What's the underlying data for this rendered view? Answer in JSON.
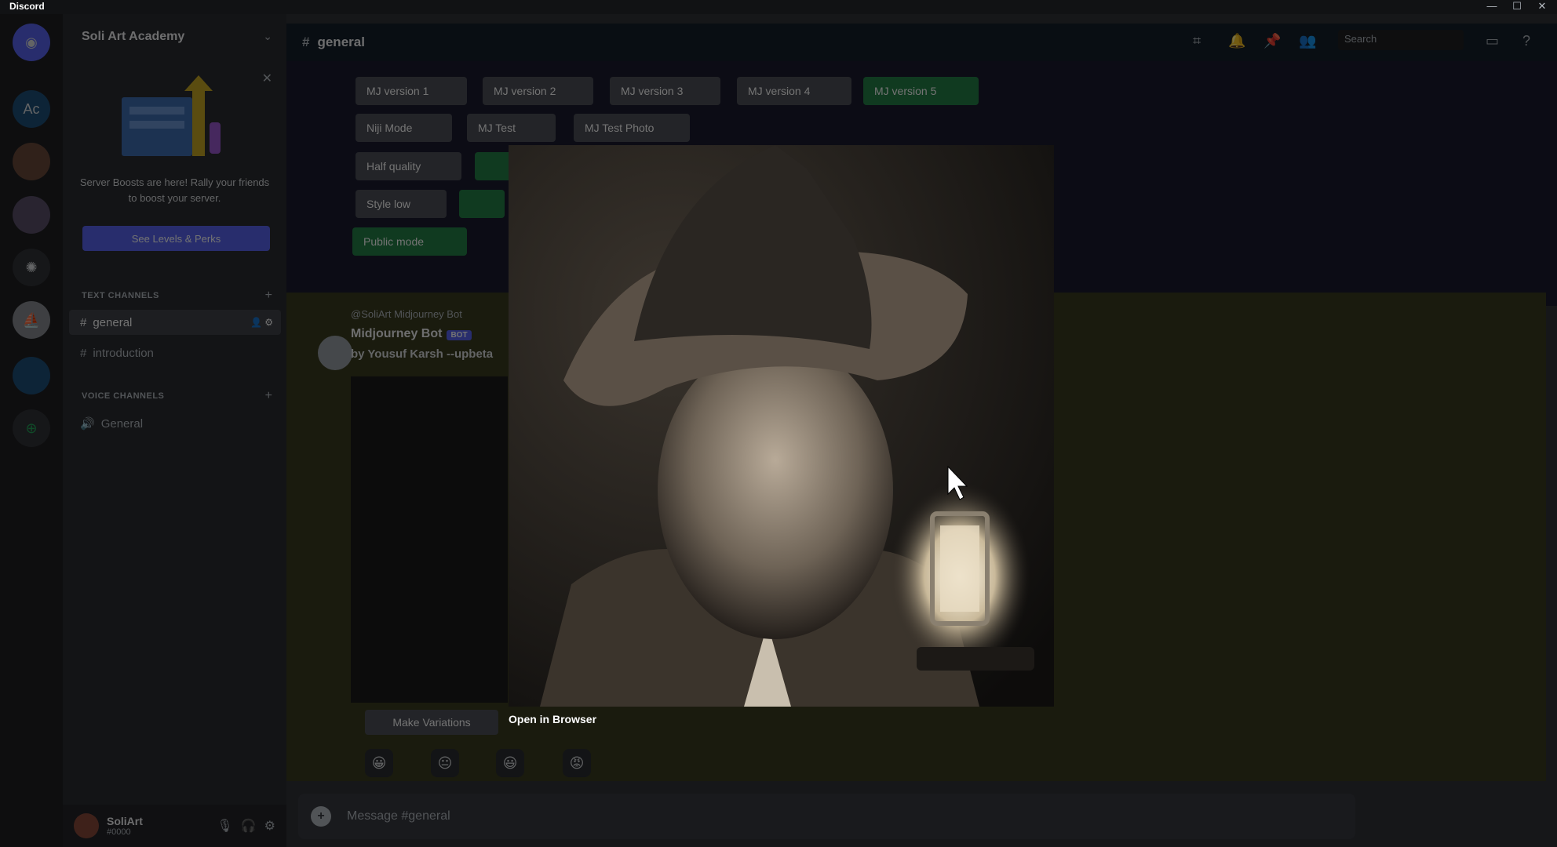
{
  "app": {
    "title": "Discord"
  },
  "window_controls": {
    "minimize": "—",
    "maximize": "☐",
    "close": "✕"
  },
  "servers": [
    {
      "name": "home",
      "label": ""
    },
    {
      "name": "ac",
      "label": "Ac"
    },
    {
      "name": "server-3",
      "label": ""
    },
    {
      "name": "server-4",
      "label": ""
    },
    {
      "name": "openai",
      "label": ""
    },
    {
      "name": "midjourney",
      "label": ""
    },
    {
      "name": "server-7",
      "label": ""
    },
    {
      "name": "explore",
      "label": "⊕"
    }
  ],
  "sidebar": {
    "server_name": "Soli Art Academy",
    "boost_text": "Server Boosts are here! Rally your friends to boost your server.",
    "boost_button": "See Levels & Perks",
    "text_category": "TEXT CHANNELS",
    "text_channels": [
      {
        "name": "general"
      },
      {
        "name": "introduction"
      }
    ],
    "voice_category": "VOICE CHANNELS",
    "voice_channels": [
      {
        "name": "General"
      }
    ],
    "user": {
      "name": "SoliArt",
      "status": "#0000"
    }
  },
  "header": {
    "channel": "general",
    "search_placeholder": "Search"
  },
  "buttons": {
    "row1": [
      "MJ version 1",
      "MJ version 2",
      "MJ version 3",
      "MJ version 4",
      "MJ version 5"
    ],
    "row2": [
      "Niji Mode",
      "MJ Test",
      "MJ Test Photo"
    ],
    "row3": [
      "Half quality"
    ],
    "row4": [
      "Style low"
    ],
    "row5": [
      "Public mode"
    ],
    "active_color": "#248046"
  },
  "message": {
    "author": "Midjourney Bot",
    "badge": "BOT",
    "prompt": "by Yousuf Karsh --upbeta",
    "reply": "@SoliArt  Midjourney Bot",
    "variations_button": "Make Variations",
    "reactions": [
      "😀",
      "😐",
      "😃",
      "😡"
    ]
  },
  "input": {
    "placeholder": "Message #general"
  },
  "lightbox": {
    "open_in_browser": "Open in Browser"
  }
}
